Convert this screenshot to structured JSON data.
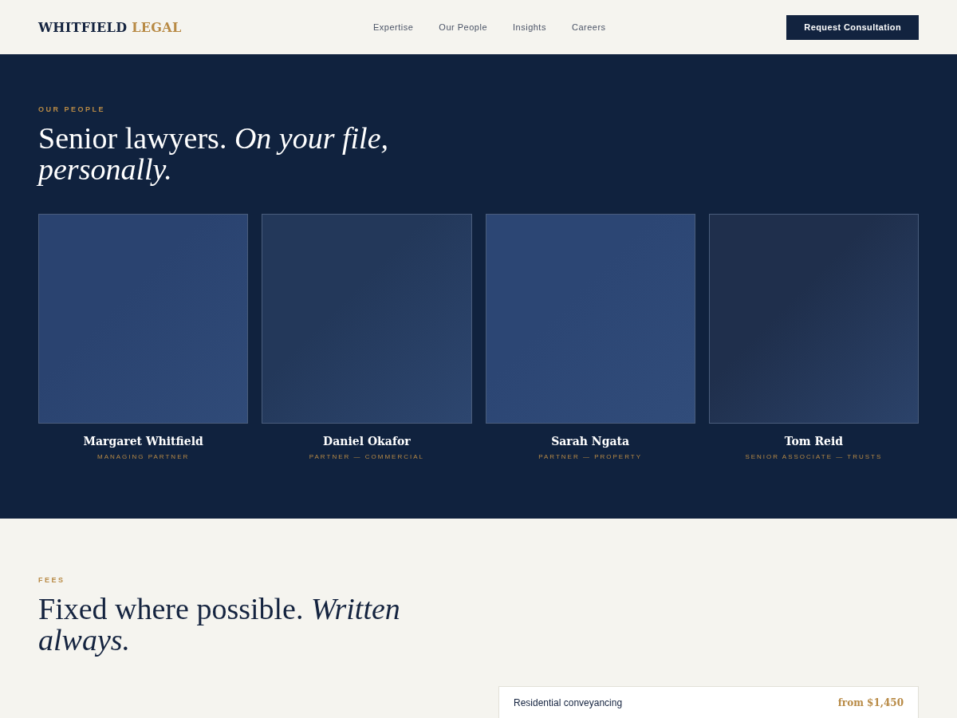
{
  "header": {
    "logo_main": "WHITFIELD",
    "logo_accent": "LEGAL",
    "nav": [
      {
        "label": "Expertise"
      },
      {
        "label": "Our People"
      },
      {
        "label": "Insights"
      },
      {
        "label": "Careers"
      }
    ],
    "cta": "Request Consultation"
  },
  "people_section": {
    "eyebrow": "OUR PEOPLE",
    "headline": "Senior lawyers. *On your file, personally.*",
    "people": [
      {
        "name": "Margaret Whitfield",
        "role": "MANAGING PARTNER",
        "color": "#2a4370"
      },
      {
        "name": "Daniel Okafor",
        "role": "PARTNER — COMMERCIAL",
        "color": "#23385a"
      },
      {
        "name": "Sarah Ngata",
        "role": "PARTNER — PROPERTY",
        "color": "#2c4674"
      },
      {
        "name": "Tom Reid",
        "role": "SENIOR ASSOCIATE — TRUSTS",
        "color": "#1f2f4c"
      }
    ]
  },
  "fees_section": {
    "eyebrow": "FEES",
    "headline": "Fixed where possible. *Written always.*",
    "fees": [
      {
        "service": "Residential conveyancing",
        "price": "from $1,450"
      }
    ]
  }
}
